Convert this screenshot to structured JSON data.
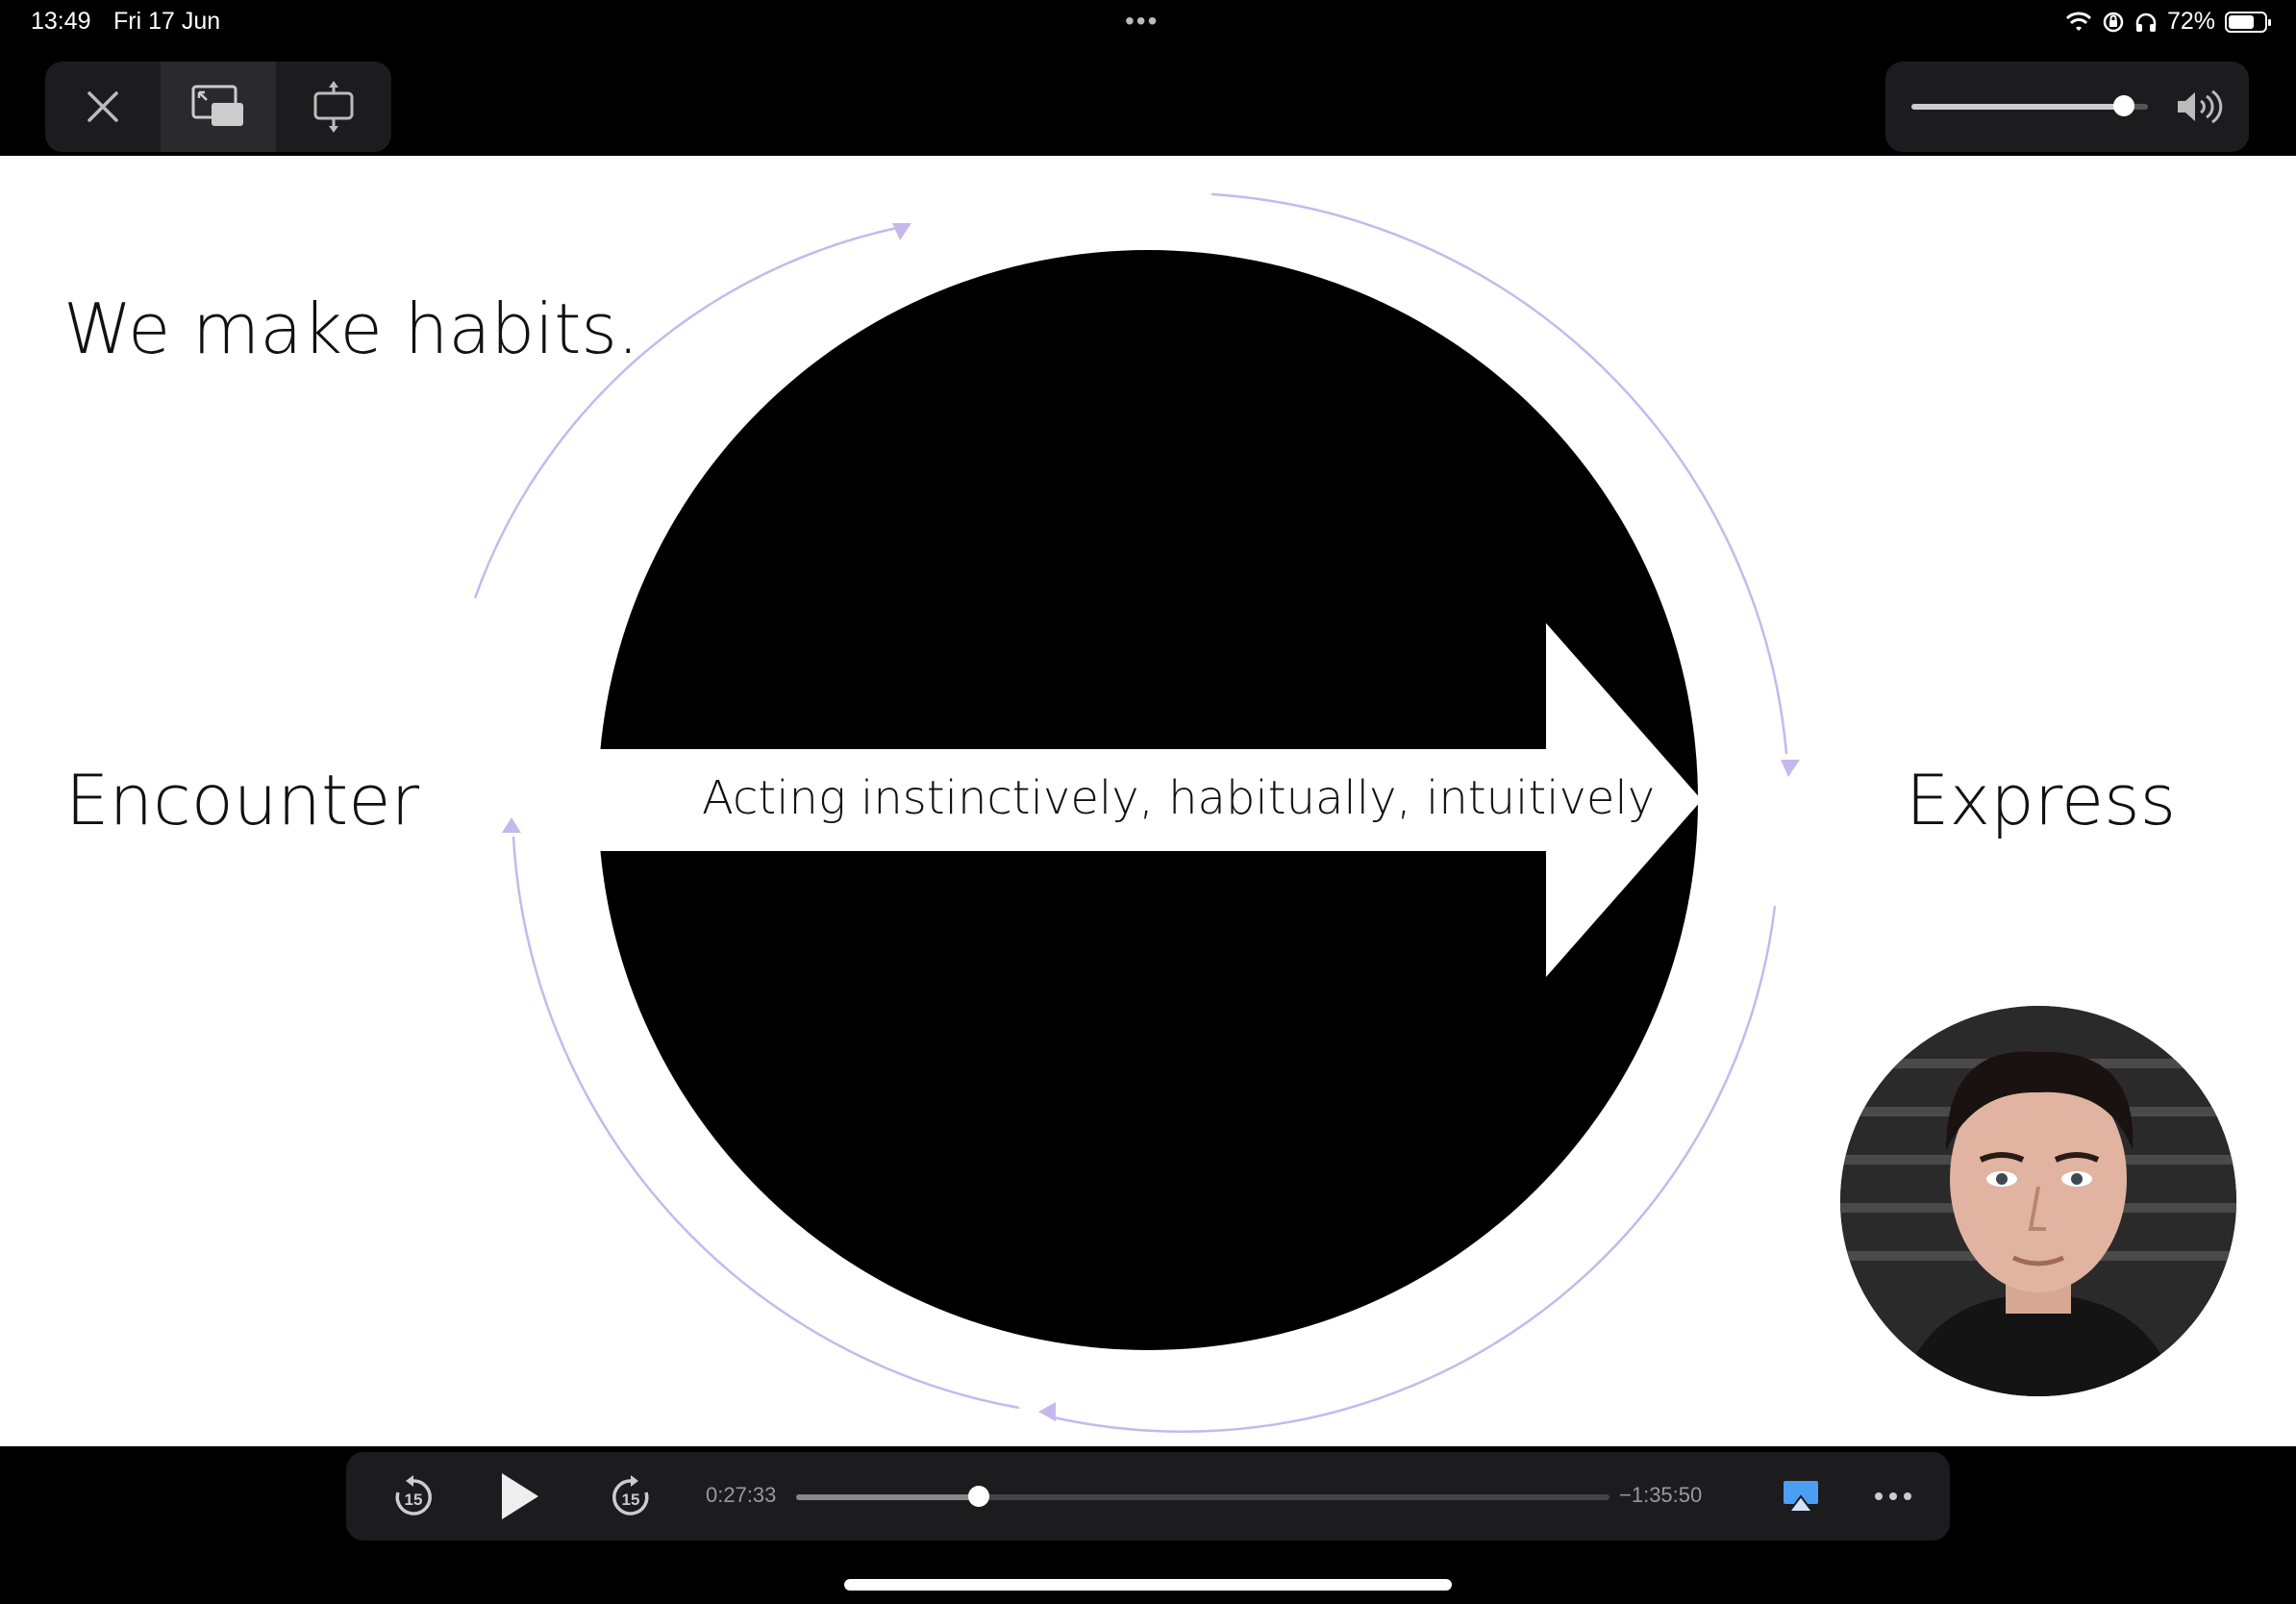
{
  "status_bar": {
    "time": "13:49",
    "date": "Fri 17 Jun",
    "battery_percent": "72%",
    "battery_level": 0.72,
    "icons": [
      "wifi-icon",
      "orientation-lock-icon",
      "headphones-icon",
      "battery-icon"
    ]
  },
  "top_controls": {
    "buttons": [
      "close-icon",
      "picture-in-picture-icon",
      "aspect-fit-icon"
    ]
  },
  "volume": {
    "level": 0.9,
    "icon": "speaker-icon"
  },
  "slide": {
    "title": "We make habits.",
    "left_label": "Encounter",
    "right_label": "Express",
    "arrow_text": "Acting instinctively, habitually, intuitively"
  },
  "player": {
    "elapsed": "0:27:33",
    "remaining": "−1:35:50",
    "progress": 0.225,
    "skip_back_label": "15",
    "skip_forward_label": "15",
    "icons": [
      "skip-back-15-icon",
      "play-icon",
      "skip-forward-15-icon",
      "airplay-icon",
      "more-icon"
    ]
  },
  "colors": {
    "bar_bg": "#1c1c1e",
    "accent_airplay": "#4a9ff5",
    "cycle_arrows": "#c7b8ec"
  }
}
